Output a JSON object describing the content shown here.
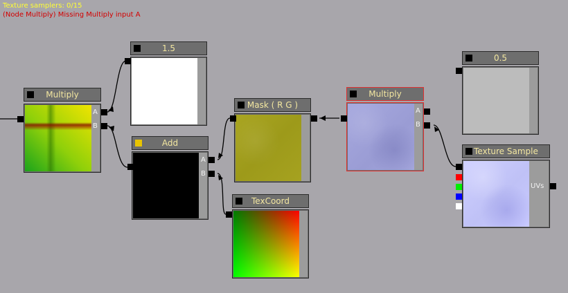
{
  "status": {
    "samplers": "Texture samplers: 0/15",
    "error": "(Node Multiply) Missing Multiply input A"
  },
  "nodes": {
    "multiply_left": {
      "title": "Multiply",
      "pin_a": "A",
      "pin_b": "B"
    },
    "const_15": {
      "title": "1.5"
    },
    "add": {
      "title": "Add",
      "pin_a": "A",
      "pin_b": "B"
    },
    "mask": {
      "title": "Mask ( R G )"
    },
    "texcoord": {
      "title": "TexCoord"
    },
    "multiply_right": {
      "title": "Multiply",
      "pin_a": "A",
      "pin_b": "B"
    },
    "const_05": {
      "title": "0.5"
    },
    "texture_sample": {
      "title": "Texture Sample",
      "output_label": "UVs"
    }
  },
  "colors": {
    "background": "#a8a6ab",
    "title_text": "#f2e6a0",
    "selection": "#e03030",
    "status_yellow": "#ffff33",
    "status_error": "#d40000"
  }
}
